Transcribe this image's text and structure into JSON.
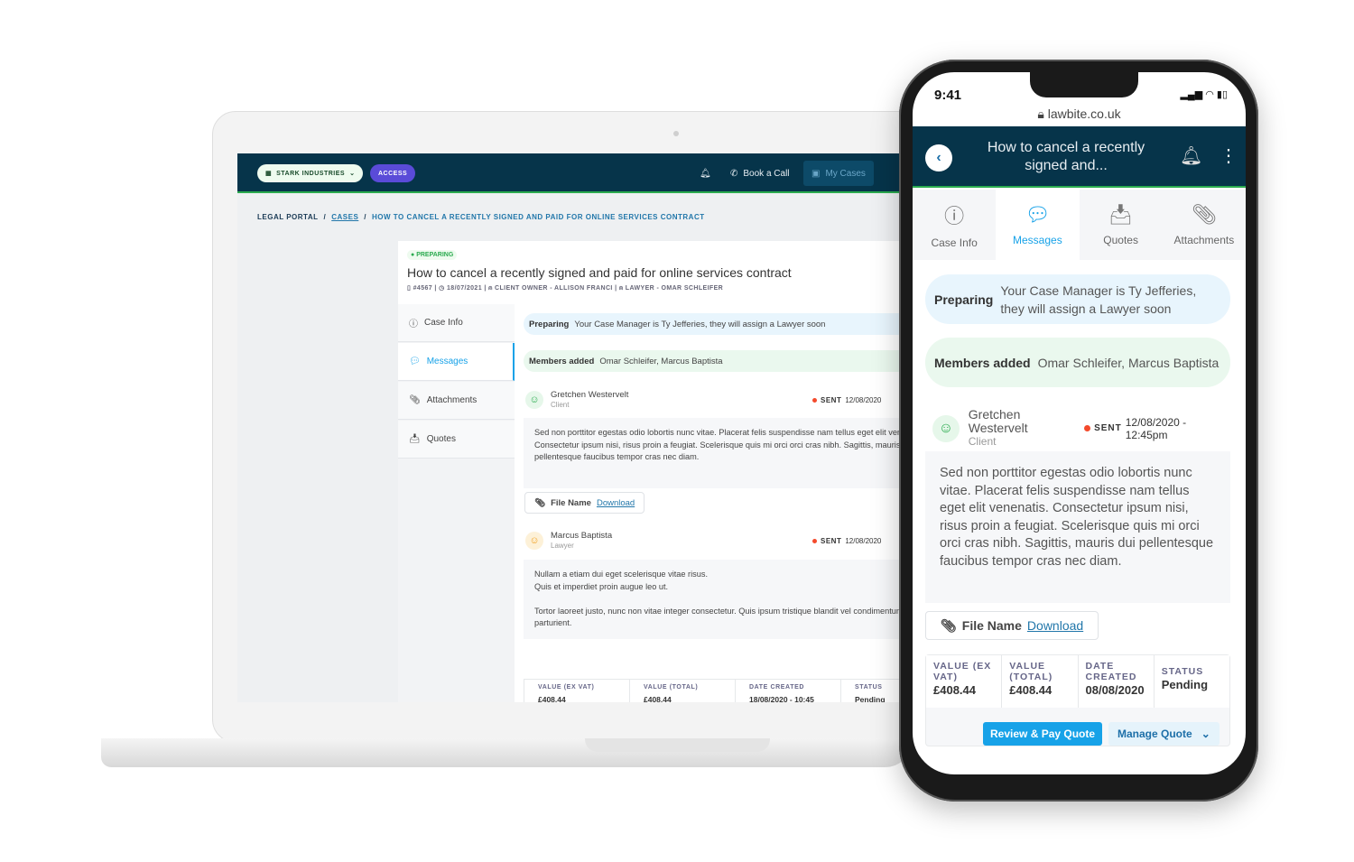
{
  "laptop": {
    "org": "STARK INDUSTRIES",
    "access": "ACCESS",
    "book_call": "Book a Call",
    "my_cases": "My Cases",
    "breadcrumb": [
      "LEGAL PORTAL",
      "CASES",
      "HOW TO CANCEL A RECENTLY SIGNED AND PAID FOR ONLINE SERVICES CONTRACT"
    ],
    "status": "PREPARING",
    "title": "How to cancel a recently signed and paid for online services contract",
    "meta": {
      "id": "#4567",
      "date": "18/07/2021",
      "client": "CLIENT OWNER - ALLISON FRANCI",
      "lawyer": "LAWYER - OMAR SCHLEIFER"
    },
    "tabs": [
      "Case Info",
      "Messages",
      "Attachments",
      "Quotes"
    ],
    "preparing": {
      "label": "Preparing",
      "text": "Your Case Manager is Ty Jefferies, they will assign a Lawyer soon"
    },
    "members": {
      "label": "Members added",
      "text": "Omar Schleifer, Marcus Baptista"
    },
    "msg1": {
      "name": "Gretchen Westervelt",
      "role": "Client",
      "sent": "SENT",
      "date": "12/08/2020",
      "body": "Sed non porttitor egestas odio lobortis nunc vitae. Placerat felis suspendisse nam tellus eget elit venenatis. Consectetur ipsum nisi, risus proin a feugiat. Scelerisque quis mi orci orci cras nibh. Sagittis, mauris dui pellentesque faucibus tempor cras nec diam."
    },
    "file": {
      "name": "File Name",
      "download": "Download"
    },
    "msg2": {
      "name": "Marcus Baptista",
      "role": "Lawyer",
      "sent": "SENT",
      "date": "12/08/2020",
      "body1": "Nullam a etiam dui eget scelerisque vitae risus.",
      "body2": "Quis et imperdiet proin augue leo ut.",
      "body3": "Tortor laoreet justo, nunc non vitae integer consectetur. Quis ipsum tristique blandit vel condimentum sem orci parturient."
    },
    "quote": {
      "h": [
        "VALUE (EX VAT)",
        "VALUE (TOTAL)",
        "DATE CREATED",
        "STATUS"
      ],
      "v": [
        "£408.44",
        "£408.44",
        "18/08/2020 - 10:45",
        "Pending"
      ]
    }
  },
  "phone": {
    "time": "9:41",
    "url": "lawbite.co.uk",
    "title": "How to cancel a recently signed and...",
    "tabs": [
      "Case Info",
      "Messages",
      "Quotes",
      "Attachments"
    ],
    "preparing": {
      "label": "Preparing",
      "text": "Your Case Manager is Ty Jefferies, they will assign a Lawyer soon"
    },
    "members": {
      "label": "Members added",
      "text": "Omar Schleifer, Marcus Baptista"
    },
    "msg": {
      "name": "Gretchen Westervelt",
      "role": "Client",
      "sent": "SENT",
      "date": "12/08/2020 - 12:45pm",
      "body": "Sed non porttitor egestas odio lobortis nunc vitae. Placerat felis suspendisse nam tellus eget elit venenatis. Consectetur ipsum nisi, risus proin a feugiat. Scelerisque quis mi orci orci cras nibh. Sagittis, mauris dui pellentesque faucibus tempor cras nec diam."
    },
    "file": {
      "name": "File Name",
      "download": "Download"
    },
    "quote": {
      "h": [
        "VALUE (EX VAT)",
        "VALUE (TOTAL)",
        "DATE CREATED",
        "STATUS"
      ],
      "v": [
        "£408.44",
        "£408.44",
        "08/08/2020",
        "Pending"
      ]
    },
    "review": "Review & Pay Quote",
    "manage": "Manage Quote"
  },
  "colors": {
    "nav": "#06344a",
    "accent": "#17a2e8",
    "green": "#2bab4f",
    "access": "#5a4bd8"
  }
}
